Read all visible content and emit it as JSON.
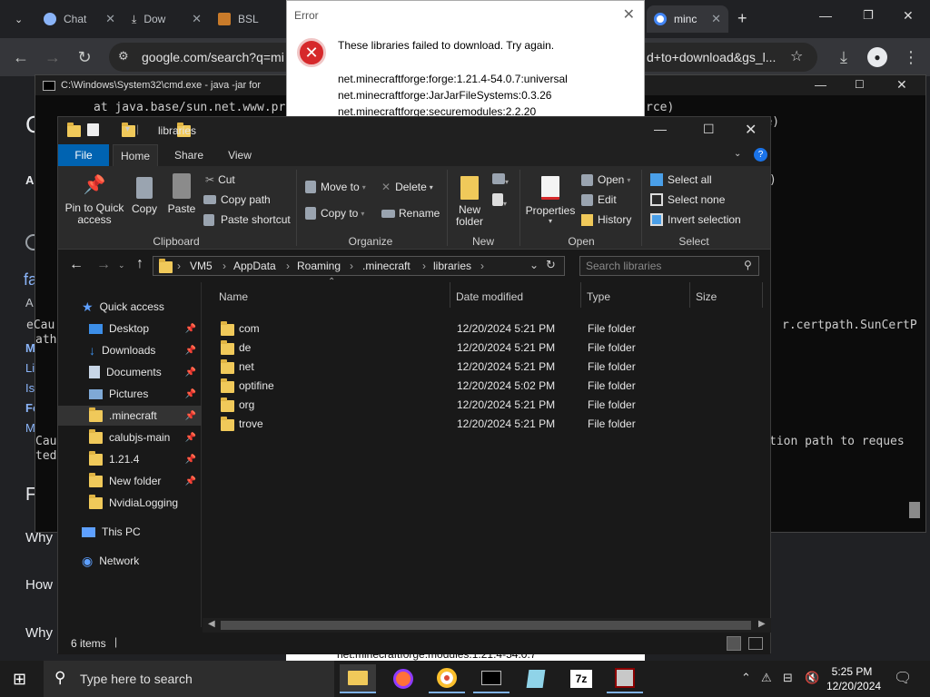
{
  "browser": {
    "tabs": [
      {
        "label": "Chat"
      },
      {
        "label": "Dow"
      },
      {
        "label": "BSL"
      },
      {
        "label": "minc"
      }
    ],
    "new_tab": "+",
    "url_left": "google.com/search?q=mi",
    "url_right": "d+to+download&gs_l..."
  },
  "google_page": {
    "heading_letter": "C",
    "left_snippets": [
      "A",
      "fa",
      "A",
      "M",
      "Li",
      "Is",
      "Fo",
      "M",
      "F",
      "Why",
      "How",
      "Why"
    ]
  },
  "cmd": {
    "title": "C:\\Windows\\System32\\cmd.exe - java  -jar for",
    "lines": [
      "at java.base/sun.net.www.pr",
      "rce)",
      "urce)",
      ")",
      "eCau",
      "ath",
      "r.certpath.SunCertP",
      "Cau",
      "ted",
      "tion path to reques"
    ]
  },
  "error_dialog": {
    "title": "Error",
    "message": "These libraries failed to download. Try again.",
    "libraries": [
      "net.minecraftforge:forge:1.21.4-54.0.7:universal",
      "net.minecraftforge:JarJarFileSystems:0.3.26",
      "net.minecraftforge:securemodules:2.2.20"
    ],
    "hidden_line": "net.minecraftforge:modules:1.21.4-54.0.7"
  },
  "explorer": {
    "title": "libraries",
    "ribbon_tabs": [
      "File",
      "Home",
      "Share",
      "View"
    ],
    "clipboard": {
      "pin": "Pin to Quick access",
      "copy": "Copy",
      "paste": "Paste",
      "cut": "Cut",
      "copy_path": "Copy path",
      "paste_shortcut": "Paste shortcut",
      "label": "Clipboard"
    },
    "organize": {
      "move_to": "Move to",
      "copy_to": "Copy to",
      "delete": "Delete",
      "rename": "Rename",
      "label": "Organize"
    },
    "new": {
      "new_folder": "New folder",
      "label": "New"
    },
    "open": {
      "properties": "Properties",
      "open": "Open",
      "edit": "Edit",
      "history": "History",
      "label": "Open"
    },
    "select": {
      "select_all": "Select all",
      "select_none": "Select none",
      "invert": "Invert selection",
      "label": "Select"
    },
    "breadcrumbs": [
      "VM5",
      "AppData",
      "Roaming",
      ".minecraft",
      "libraries"
    ],
    "search_placeholder": "Search libraries",
    "nav": [
      {
        "label": "Quick access"
      },
      {
        "label": "Desktop"
      },
      {
        "label": "Downloads"
      },
      {
        "label": "Documents"
      },
      {
        "label": "Pictures"
      },
      {
        "label": ".minecraft"
      },
      {
        "label": "calubjs-main"
      },
      {
        "label": "1.21.4"
      },
      {
        "label": "New folder"
      },
      {
        "label": "NvidiaLogging"
      },
      {
        "label": "This PC"
      },
      {
        "label": "Network"
      }
    ],
    "columns": {
      "name": "Name",
      "date": "Date modified",
      "type": "Type",
      "size": "Size"
    },
    "files": [
      {
        "name": "com",
        "date": "12/20/2024 5:21 PM",
        "type": "File folder"
      },
      {
        "name": "de",
        "date": "12/20/2024 5:21 PM",
        "type": "File folder"
      },
      {
        "name": "net",
        "date": "12/20/2024 5:21 PM",
        "type": "File folder"
      },
      {
        "name": "optifine",
        "date": "12/20/2024 5:02 PM",
        "type": "File folder"
      },
      {
        "name": "org",
        "date": "12/20/2024 5:21 PM",
        "type": "File folder"
      },
      {
        "name": "trove",
        "date": "12/20/2024 5:21 PM",
        "type": "File folder"
      }
    ],
    "status": "6 items"
  },
  "taskbar": {
    "search_placeholder": "Type here to search",
    "time": "5:25 PM",
    "date": "12/20/2024"
  },
  "colors": {
    "accent": "#0063b1",
    "folder": "#f0c95a",
    "error": "#d6282b"
  }
}
